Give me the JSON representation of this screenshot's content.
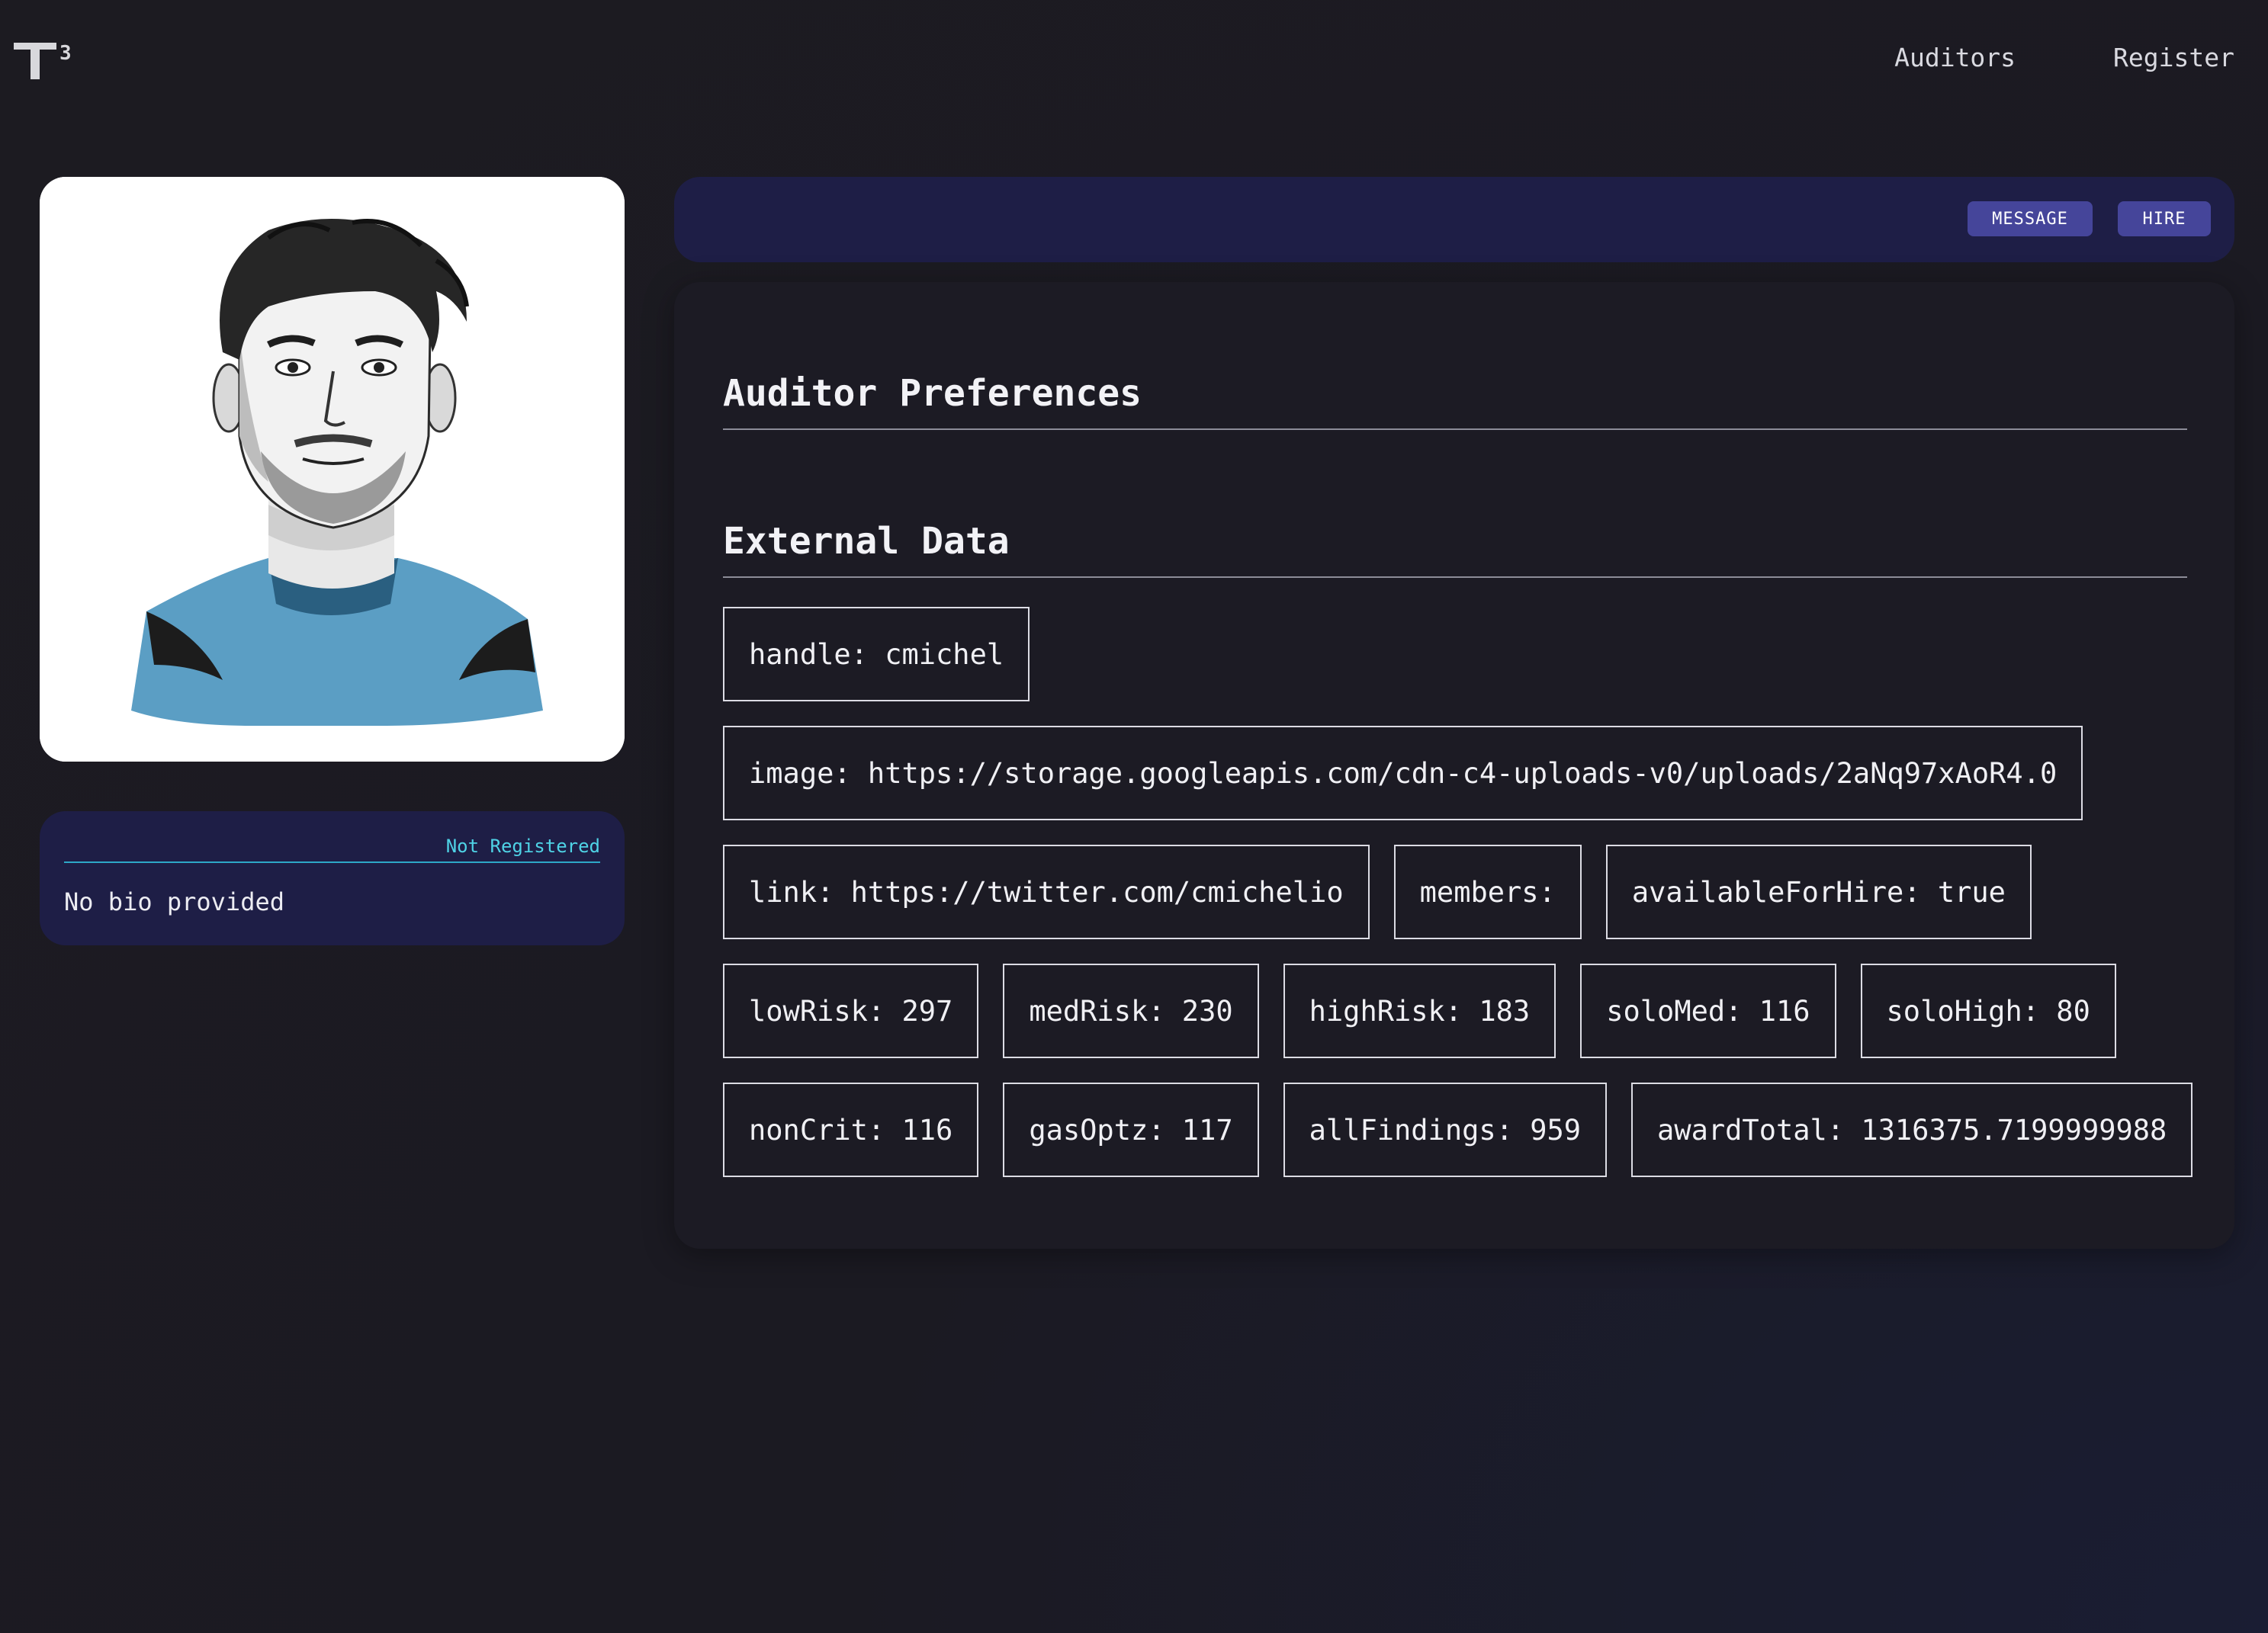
{
  "header": {
    "logo": {
      "letter": "T",
      "superscript": "3"
    },
    "nav": [
      {
        "label": "Auditors"
      },
      {
        "label": "Register"
      }
    ]
  },
  "profile": {
    "avatar_alt": "avatar-illustration",
    "status": "Not Registered",
    "bio": "No bio provided"
  },
  "actions": {
    "message_label": "MESSAGE",
    "hire_label": "HIRE"
  },
  "sections": {
    "preferences_title": "Auditor Preferences",
    "external_title": "External Data"
  },
  "external_data": {
    "row1": [
      "handle: cmichel"
    ],
    "row2": [
      "image: https://storage.googleapis.com/cdn-c4-uploads-v0/uploads/2aNq97xAoR4.0"
    ],
    "row3": [
      "link: https://twitter.com/cmichelio",
      "members:",
      "availableForHire: true"
    ],
    "row4": [
      "lowRisk: 297",
      "medRisk: 230",
      "highRisk: 183",
      "soloMed: 116",
      "soloHigh: 80"
    ],
    "row5": [
      "nonCrit: 116",
      "gasOptz: 117",
      "allFindings: 959",
      "awardTotal: 1316375.7199999988"
    ]
  },
  "colors": {
    "background": "#1c1b21",
    "card": "#1e1e46",
    "button": "#45459a",
    "status_accent": "#4fd3e6",
    "shirt_blue": "#5b9ec4"
  }
}
